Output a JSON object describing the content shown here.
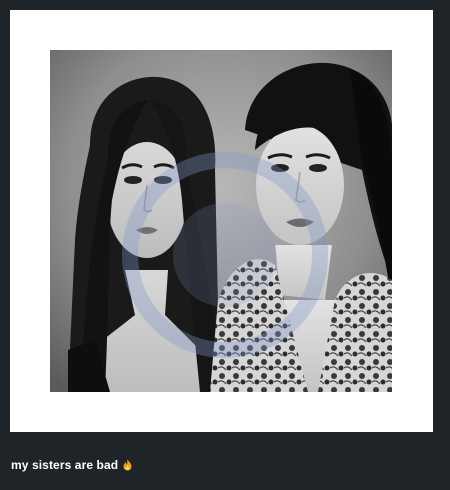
{
  "post": {
    "photo": {
      "style": "black-and-white",
      "watermark_color": "#7f97c9",
      "subject_icons": [
        "woman-left-portrait",
        "woman-right-portrait"
      ]
    },
    "caption": {
      "text": "my sisters are bad",
      "emoji": "fire-emoji-icon"
    }
  },
  "colors": {
    "background": "#1e2428",
    "card": "#ffffff",
    "caption_text": "#ffffff",
    "fire": "#f39c12"
  }
}
